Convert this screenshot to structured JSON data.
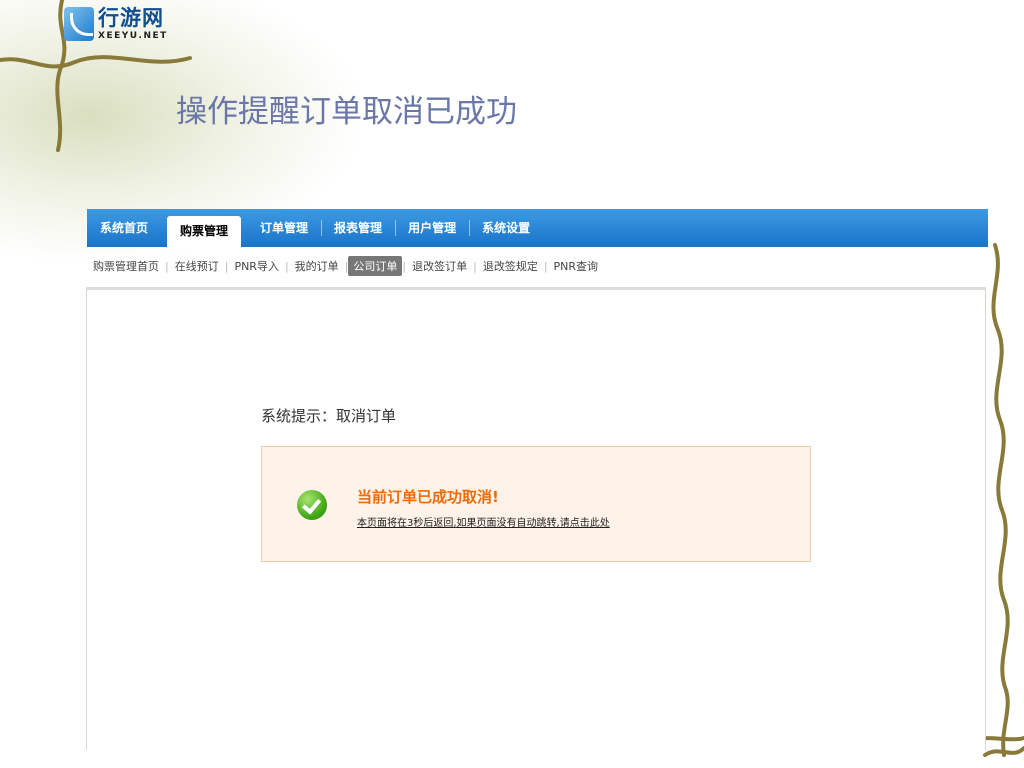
{
  "logo": {
    "cn": "行游网",
    "en": "XEEYU.NET"
  },
  "slide_title": "操作提醒订单取消已成功",
  "main_nav": [
    {
      "label": "系统首页",
      "active": false
    },
    {
      "label": "购票管理",
      "active": true
    },
    {
      "label": "订单管理",
      "active": false
    },
    {
      "label": "报表管理",
      "active": false
    },
    {
      "label": "用户管理",
      "active": false
    },
    {
      "label": "系统设置",
      "active": false
    }
  ],
  "sub_nav": [
    {
      "label": "购票管理首页",
      "active": false
    },
    {
      "label": "在线预订",
      "active": false
    },
    {
      "label": "PNR导入",
      "active": false
    },
    {
      "label": "我的订单",
      "active": false
    },
    {
      "label": "公司订单",
      "active": true
    },
    {
      "label": "退改签订单",
      "active": false
    },
    {
      "label": "退改签规定",
      "active": false
    },
    {
      "label": "PNR查询",
      "active": false
    }
  ],
  "notice": {
    "heading": "系统提示：取消订单",
    "title": "当前订单已成功取消!",
    "link_text": "本页面将在3秒后返回,如果页面没有自动跳转,请点击此处"
  },
  "colors": {
    "nav_blue": "#1b73c9",
    "notice_orange": "#ee6b0a",
    "notice_bg": "#fff3e9",
    "title_color": "#6a77a8"
  },
  "icons": [
    "success-check-icon",
    "logo-icon"
  ]
}
